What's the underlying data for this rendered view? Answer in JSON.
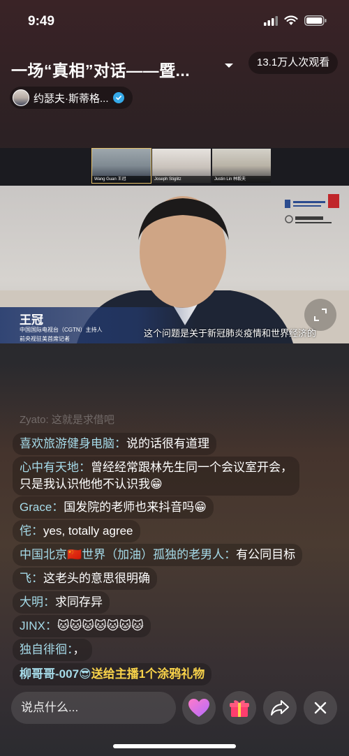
{
  "status": {
    "time": "9:49"
  },
  "header": {
    "title": "一场“真相”对话——暨...",
    "viewers": "13.1万人次观看",
    "host_name": "约瑟夫·斯蒂格..."
  },
  "video": {
    "thumbnails": [
      "Wang Guan 王冠",
      "Joseph Stiglitz",
      "Justin Lin 林毅夫"
    ],
    "speaker_name": "王冠",
    "speaker_title_1": "中国国际电视台（CGTN）主持人",
    "speaker_title_2": "前央视驻美首席记者",
    "subtitle": "这个问题是关于新冠肺炎疫情和世界经济的"
  },
  "chat": {
    "faded": "Zyato: 这就是求借吧",
    "messages": [
      {
        "user": "喜欢旅游健身电脑：",
        "text": "说的话很有道理"
      },
      {
        "user": "心中有天地：",
        "text": "曾经经常跟林先生同一个会议室开会，",
        "text2": "只是我认识他他不认识我😁"
      },
      {
        "user": "Grace：",
        "text": "国发院的老师也来抖音吗😁"
      },
      {
        "user": "侘：",
        "text": "yes, totally agree"
      },
      {
        "user": "中国北京🇨🇳世界（加油）孤独的老男人：",
        "text": "有公同目标"
      },
      {
        "user": "飞：",
        "text": "这老头的意思很明确"
      },
      {
        "user": "大明：",
        "text": "求同存异"
      },
      {
        "user": "JINX：",
        "text": "🐱🐱🐱🐱🐱🐱🐱"
      },
      {
        "user": "独自徘徊：",
        "text": "，"
      }
    ],
    "gift": {
      "user": "柳哥哥-007😎",
      "text": "送给主播1个涂鸦礼物"
    }
  },
  "bottom": {
    "input_placeholder": "说点什么..."
  },
  "colors": {
    "verified": "#35a9e8",
    "chat_user": "#a6dbe9",
    "gift_text": "#f8d24a"
  }
}
